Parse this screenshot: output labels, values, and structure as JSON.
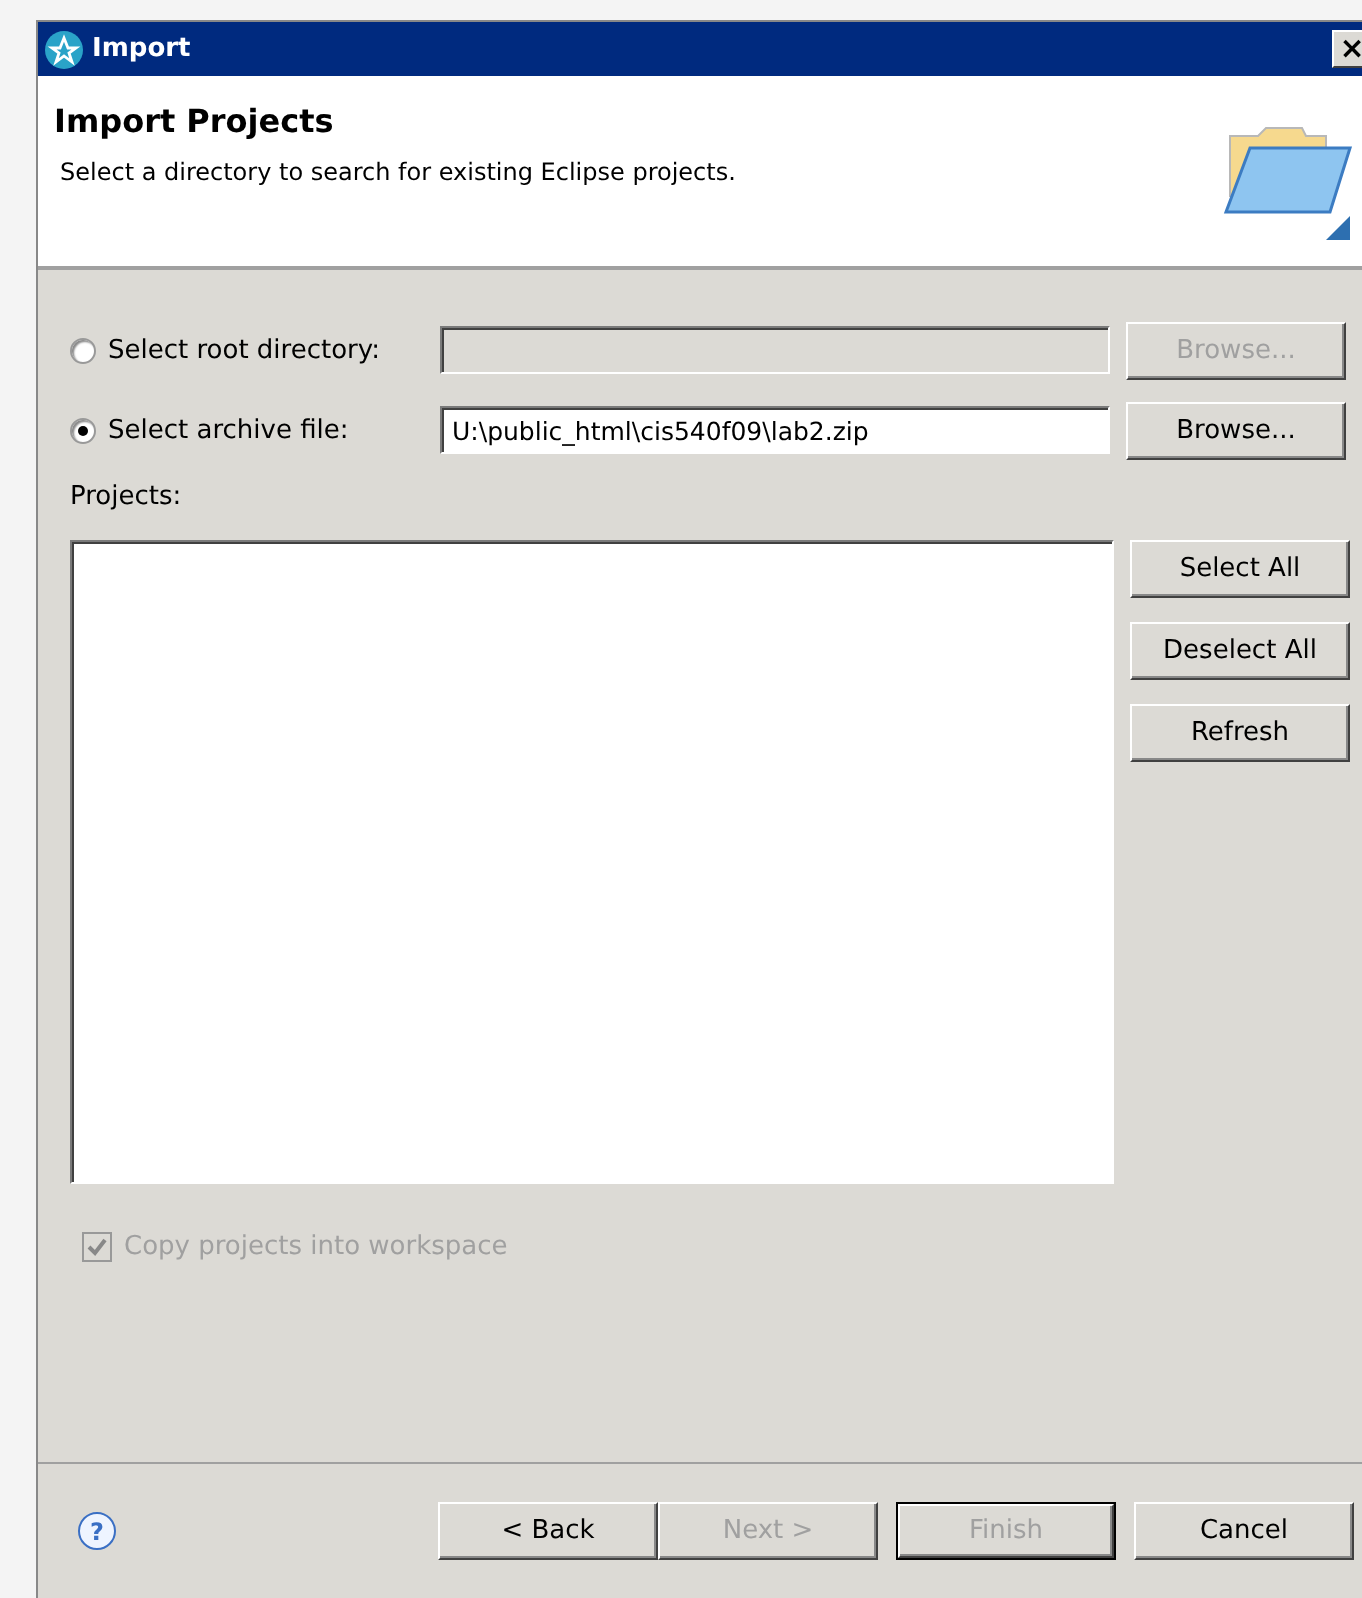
{
  "window": {
    "title": "Import",
    "close": "×"
  },
  "header": {
    "title": "Import Projects",
    "description": "Select a directory to search for existing Eclipse projects."
  },
  "sources": [
    {
      "label": "Select root directory:",
      "selected": false,
      "browse": "Browse..."
    },
    {
      "label": "Select archive file:",
      "selected": true,
      "value": "U:\\public_html\\cis540f09\\lab2.zip",
      "browse": "Browse..."
    }
  ],
  "projects": {
    "label": "Projects:",
    "buttons": [
      "Select All",
      "Deselect All",
      "Refresh"
    ]
  },
  "copy_option": {
    "label": "Copy projects into workspace",
    "checked": true,
    "disabled": true
  },
  "footer": {
    "help": "?",
    "buttons": [
      {
        "label": "< Back",
        "disabled": false,
        "default": false
      },
      {
        "label": "Next >",
        "disabled": true,
        "default": false
      },
      {
        "label": "Finish",
        "disabled": true,
        "default": true
      },
      {
        "label": "Cancel",
        "disabled": false,
        "default": false
      }
    ]
  }
}
